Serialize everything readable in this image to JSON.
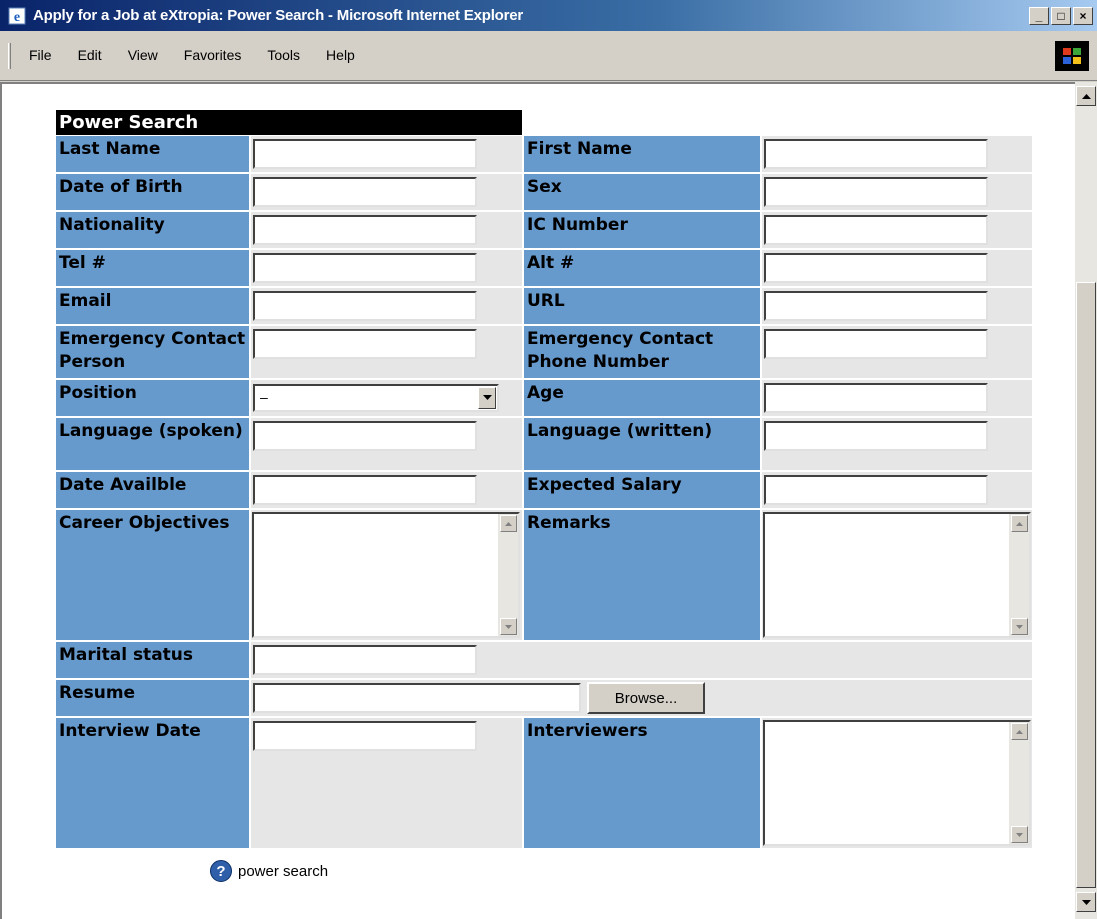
{
  "window": {
    "title": "Apply for a Job at eXtropia: Power Search - Microsoft Internet Explorer",
    "minimize": "_",
    "maximize": "□",
    "close": "×"
  },
  "menu": [
    "File",
    "Edit",
    "View",
    "Favorites",
    "Tools",
    "Help"
  ],
  "form": {
    "title": "Power Search",
    "labels": {
      "last_name": "Last Name",
      "first_name": "First Name",
      "dob": "Date of Birth",
      "sex": "Sex",
      "nationality": "Nationality",
      "ic_number": "IC Number",
      "tel": "Tel #",
      "alt": "Alt #",
      "email": "Email",
      "url": "URL",
      "emergency_person": "Emergency Contact Person",
      "emergency_phone": "Emergency Contact Phone Number",
      "position": "Position",
      "age": "Age",
      "lang_spoken": "Language (spoken)",
      "lang_written": "Language (written)",
      "date_available": "Date Availble",
      "expected_salary": "Expected Salary",
      "career_objectives": "Career Objectives",
      "remarks": "Remarks",
      "marital_status": "Marital status",
      "resume": "Resume",
      "interview_date": "Interview Date",
      "interviewers": "Interviewers"
    },
    "position_selected": "–",
    "browse_label": "Browse...",
    "help_link": "power search",
    "help_icon": "?"
  },
  "colors": {
    "label_bg": "#6699cc",
    "input_cell_bg": "#e6e6e6",
    "title_bg": "#000000"
  }
}
